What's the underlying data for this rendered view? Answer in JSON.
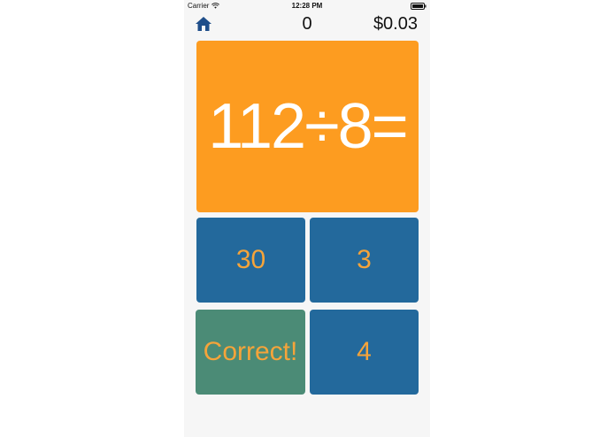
{
  "status_bar": {
    "carrier": "Carrier",
    "time": "12:28 PM",
    "icons": [
      "wifi-icon",
      "battery-icon"
    ]
  },
  "nav": {
    "home_icon": "home-icon",
    "score": "0",
    "money": "$0.03",
    "accent_color": "#1f4e8a"
  },
  "question": {
    "text": "112÷8=",
    "color": "#fd9c20"
  },
  "answers": [
    {
      "label": "30",
      "color": "#23699c"
    },
    {
      "label": "3",
      "color": "#23699c"
    },
    {
      "label": "Correct!",
      "color": "#4b8b76"
    },
    {
      "label": "4",
      "color": "#23699c"
    }
  ],
  "answer_text_color": "#f5a43a"
}
